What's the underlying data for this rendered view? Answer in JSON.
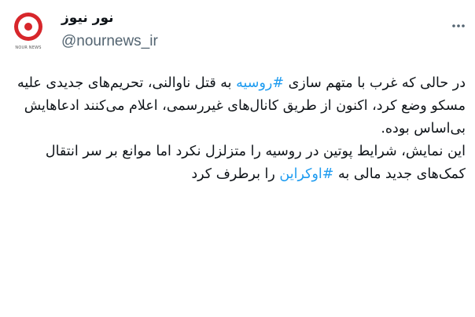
{
  "account": {
    "display_name": "نور نیوز",
    "handle": "@nournews_ir",
    "avatar_caption": "NOUR NEWS",
    "avatar_color": "#d7262b"
  },
  "more_icon": "more-dots-icon",
  "tweet": {
    "p1_before": "در حالی که غرب با متهم سازی ",
    "p1_hashtag": "#روسیه",
    "p1_after": " به قتل ناوالنی، تحریم‌های جدیدی علیه مسکو وضع کرد، اکنون از طریق کانال‌های غیررسمی، اعلام می‌کنند ادعاهایش بی‌اساس بوده.",
    "p2_before": "این نمایش، شرایط پوتین در روسیه را متزلزل نکرد اما موانع بر سر انتقال کمک‌های جدید مالی به ",
    "p2_hashtag": "#اوکراین",
    "p2_after": " را برطرف کرد"
  },
  "colors": {
    "text": "#0f1419",
    "muted": "#536471",
    "link": "#1d9bf0"
  }
}
